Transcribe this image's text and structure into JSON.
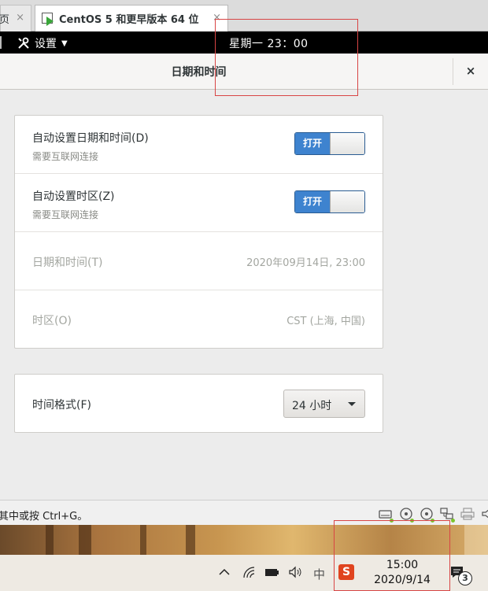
{
  "vm_tabs": {
    "prev_tab_label": "页",
    "active_tab_label": "CentOS 5 和更早版本 64 位",
    "close_glyph": "×"
  },
  "topbar": {
    "menu_label": "设置",
    "clock": "星期一 23：00"
  },
  "window": {
    "title": "日期和时间",
    "close_glyph": "×"
  },
  "datetime_settings": {
    "rows": [
      {
        "label": "自动设置日期和时间(D)",
        "sublabel": "需要互联网连接",
        "switch_label": "打开",
        "state": "on"
      },
      {
        "label": "自动设置时区(Z)",
        "sublabel": "需要互联网连接",
        "switch_label": "打开",
        "state": "on"
      },
      {
        "label": "日期和时间(T)",
        "value": "2020年09月14日, 23:00"
      },
      {
        "label": "时区(O)",
        "value": "CST (上海, 中国)"
      }
    ]
  },
  "time_format": {
    "label": "时间格式(F)",
    "selected": "24 小时"
  },
  "statusbar": {
    "hint": "其中或按 Ctrl+G。"
  },
  "taskbar": {
    "ime_label": "中",
    "sogou_label": "S",
    "time": "15:00",
    "date": "2020/9/14",
    "notification_count": "3"
  },
  "colors": {
    "switch_on": "#3e83cf",
    "annotation": "#d84545",
    "device_led": "#7cc42c"
  }
}
